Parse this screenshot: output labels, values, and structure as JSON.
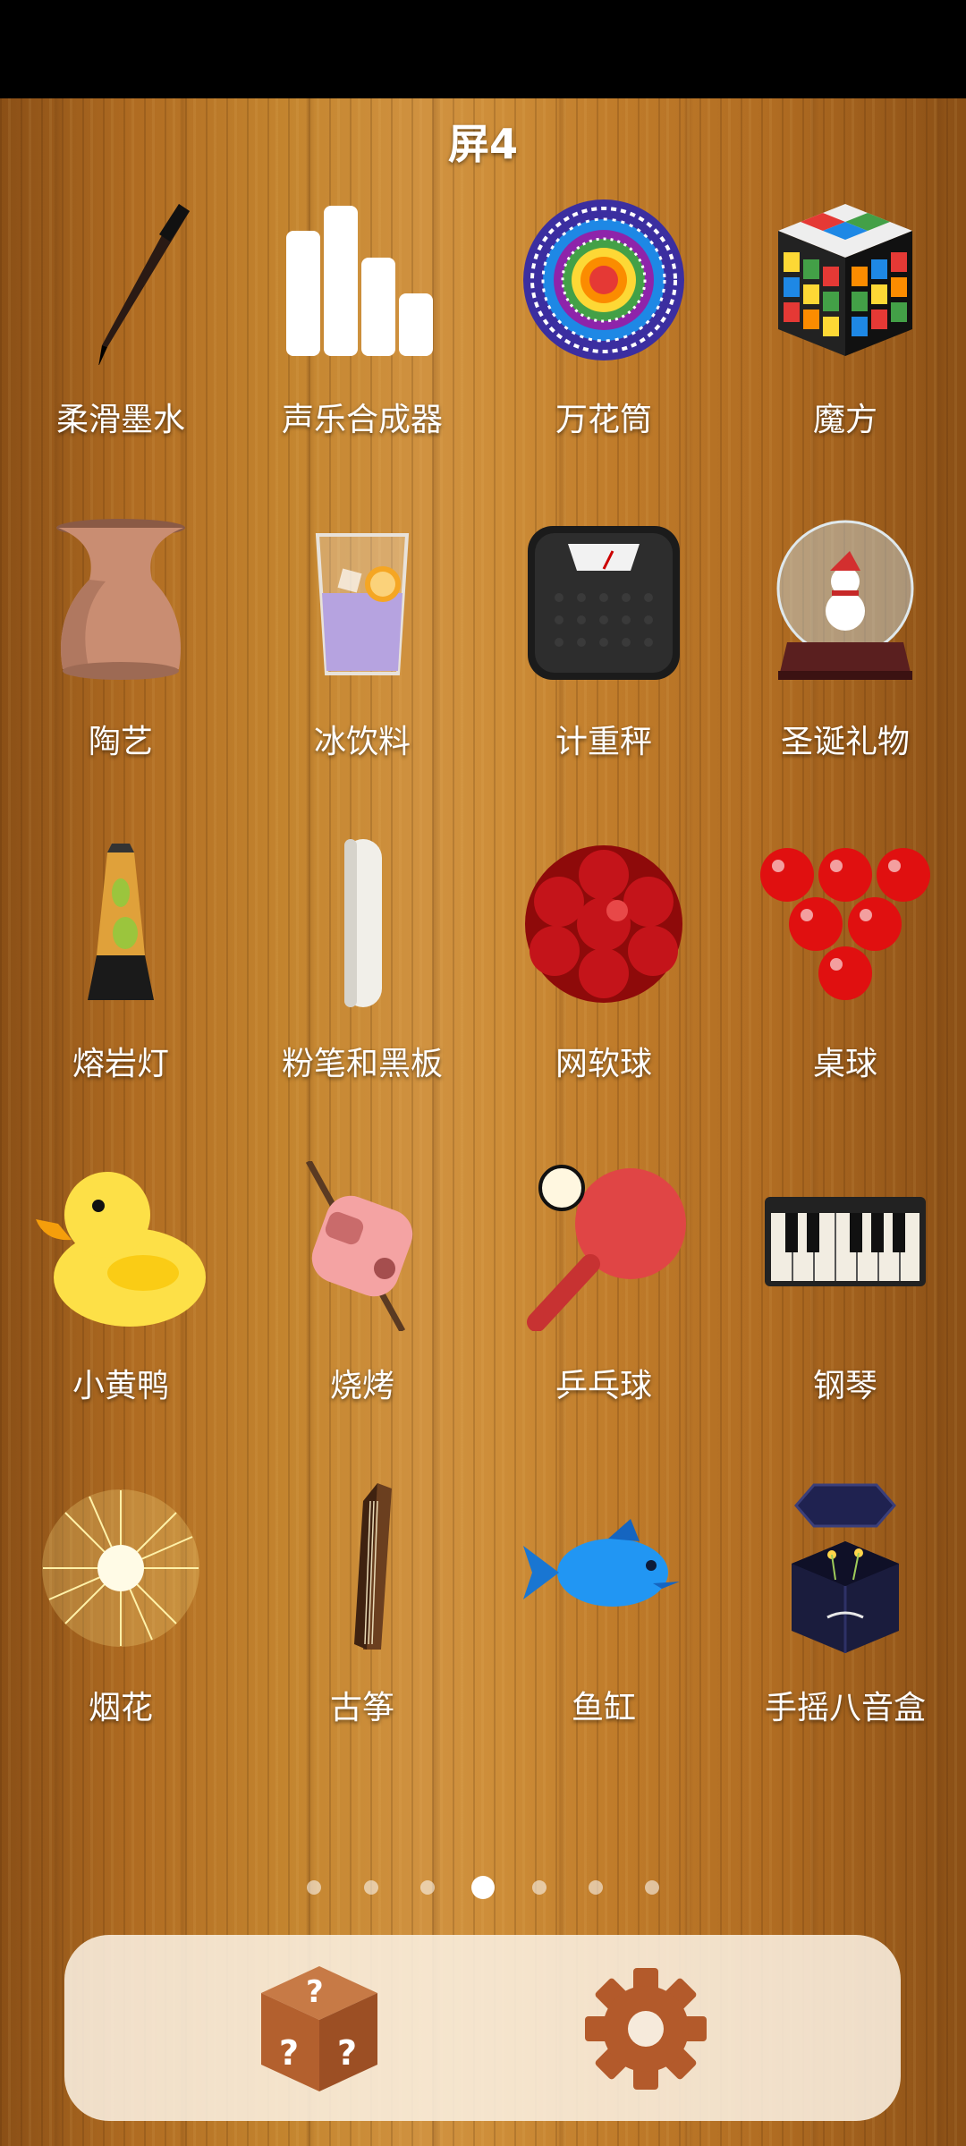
{
  "header": {
    "title": "屏4"
  },
  "apps": [
    {
      "label": "柔滑墨水",
      "icon": "ink-brush-icon"
    },
    {
      "label": "声乐合成器",
      "icon": "bars-icon"
    },
    {
      "label": "万花筒",
      "icon": "kaleidoscope-icon"
    },
    {
      "label": "魔方",
      "icon": "rubiks-cube-icon"
    },
    {
      "label": "陶艺",
      "icon": "pottery-vase-icon"
    },
    {
      "label": "冰饮料",
      "icon": "iced-drink-icon"
    },
    {
      "label": "计重秤",
      "icon": "scale-icon"
    },
    {
      "label": "圣诞礼物",
      "icon": "snow-globe-icon"
    },
    {
      "label": "熔岩灯",
      "icon": "lava-lamp-icon"
    },
    {
      "label": "粉笔和黑板",
      "icon": "chalk-icon"
    },
    {
      "label": "网软球",
      "icon": "squishy-ball-icon"
    },
    {
      "label": "桌球",
      "icon": "billiard-balls-icon"
    },
    {
      "label": "小黄鸭",
      "icon": "rubber-duck-icon"
    },
    {
      "label": "烧烤",
      "icon": "marshmallow-icon"
    },
    {
      "label": "乒乓球",
      "icon": "ping-pong-icon"
    },
    {
      "label": "钢琴",
      "icon": "piano-icon"
    },
    {
      "label": "烟花",
      "icon": "firework-icon"
    },
    {
      "label": "古筝",
      "icon": "guzheng-icon"
    },
    {
      "label": "鱼缸",
      "icon": "fish-icon"
    },
    {
      "label": "手摇八音盒",
      "icon": "music-box-icon"
    }
  ],
  "pagination": {
    "total": 7,
    "current": 4
  },
  "bottom_bar": {
    "left_icon": "random-box-icon",
    "right_icon": "gear-icon"
  },
  "colors": {
    "wood": "#c4852f",
    "label": "#ffffff",
    "bar": "#faf0e1",
    "accent": "#b35a2b"
  }
}
